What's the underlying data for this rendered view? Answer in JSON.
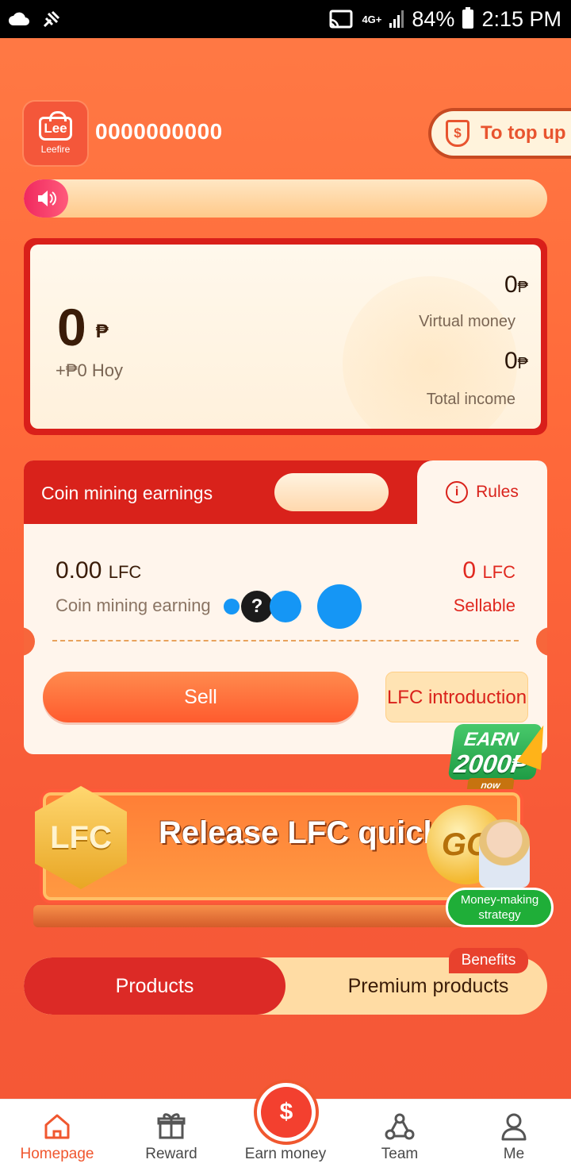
{
  "status_bar": {
    "network": "4G+",
    "battery": "84%",
    "time": "2:15 PM"
  },
  "header": {
    "logo_text": "Lee",
    "logo_sub": "Leefire",
    "account_id": "0000000000",
    "topup_icon": "$",
    "topup_label": "To top up"
  },
  "balance": {
    "main_value": "0",
    "currency": "₱",
    "today": "+₱0 Hoy",
    "virtual_value": "0",
    "virtual_label": "Virtual money",
    "total_value": "0",
    "total_label": "Total income"
  },
  "mining": {
    "title": "Coin mining earnings",
    "rules_label": "Rules",
    "rules_icon": "i",
    "earnings_value": "0.00",
    "earnings_unit": "LFC",
    "earnings_label": "Coin mining earning",
    "sellable_value": "0",
    "sellable_unit": "LFC",
    "sellable_label": "Sellable",
    "help_mark": "?",
    "sell_label": "Sell",
    "intro_label": "LFC introduction"
  },
  "promo": {
    "earn_line1": "EARN",
    "earn_line2": "2000₱",
    "earn_line3": "now",
    "banner_badge": "LFC",
    "banner_text": "Release LFC quickly",
    "go_label": "GO",
    "strategy_label": "Money-making strategy"
  },
  "product_tabs": {
    "products": "Products",
    "premium": "Premium products",
    "benefits": "Benefits"
  },
  "bottom_nav": {
    "home": "Homepage",
    "reward": "Reward",
    "earn": "Earn money",
    "earn_icon": "$",
    "team": "Team",
    "me": "Me"
  },
  "colors": {
    "accent": "#f0572f",
    "primary_red": "#d9221b",
    "background": "#ff6a3a"
  }
}
